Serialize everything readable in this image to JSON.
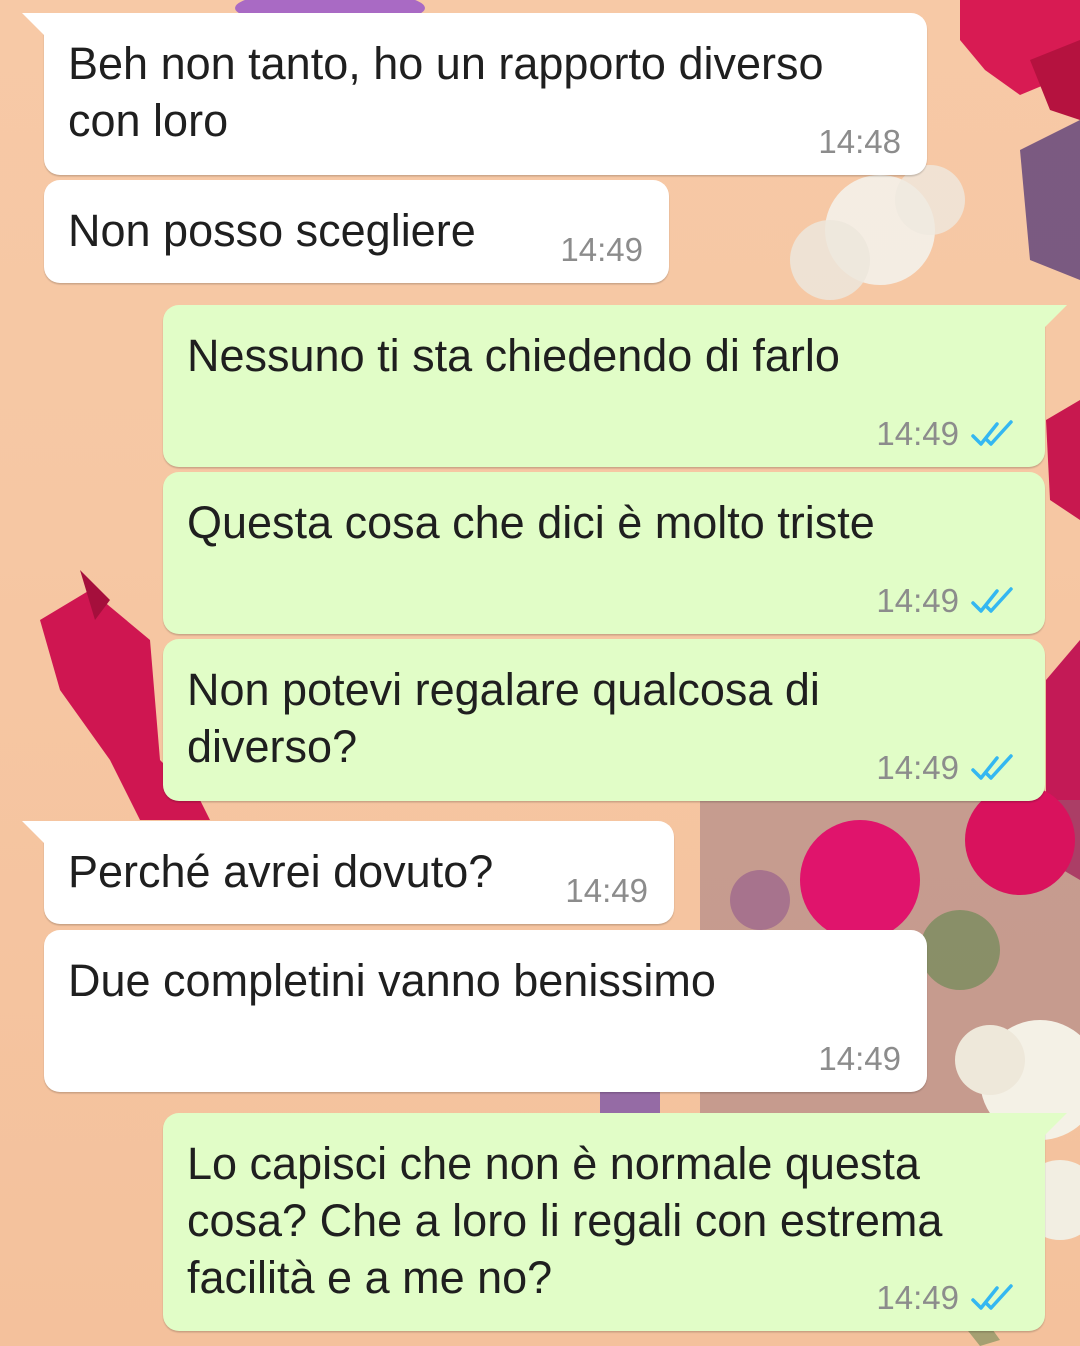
{
  "colors": {
    "incoming_bubble": "#ffffff",
    "outgoing_bubble": "#e1fdc7",
    "read_ticks": "#34b7f1",
    "timestamp": "#8c8c8c"
  },
  "messages": [
    {
      "direction": "in",
      "text": "Beh non tanto, ho un rapporto diverso\ncon loro",
      "time": "14:48"
    },
    {
      "direction": "in",
      "text": "Non posso scegliere",
      "time": "14:49"
    },
    {
      "direction": "out",
      "text": "Nessuno ti sta chiedendo di farlo",
      "time": "14:49",
      "status": "read"
    },
    {
      "direction": "out",
      "text": "Questa cosa che dici è molto triste",
      "time": "14:49",
      "status": "read"
    },
    {
      "direction": "out",
      "text": "Non potevi regalare qualcosa di\ndiverso?",
      "time": "14:49",
      "status": "read"
    },
    {
      "direction": "in",
      "text": "Perché avrei dovuto?",
      "time": "14:49"
    },
    {
      "direction": "in",
      "text": "Due completini vanno benissimo",
      "time": "14:49"
    },
    {
      "direction": "out",
      "text": "Lo capisci che non è normale questa\ncosa? Che a loro li regali con estrema\nfacilità e a me no?",
      "time": "14:49",
      "status": "read"
    }
  ]
}
